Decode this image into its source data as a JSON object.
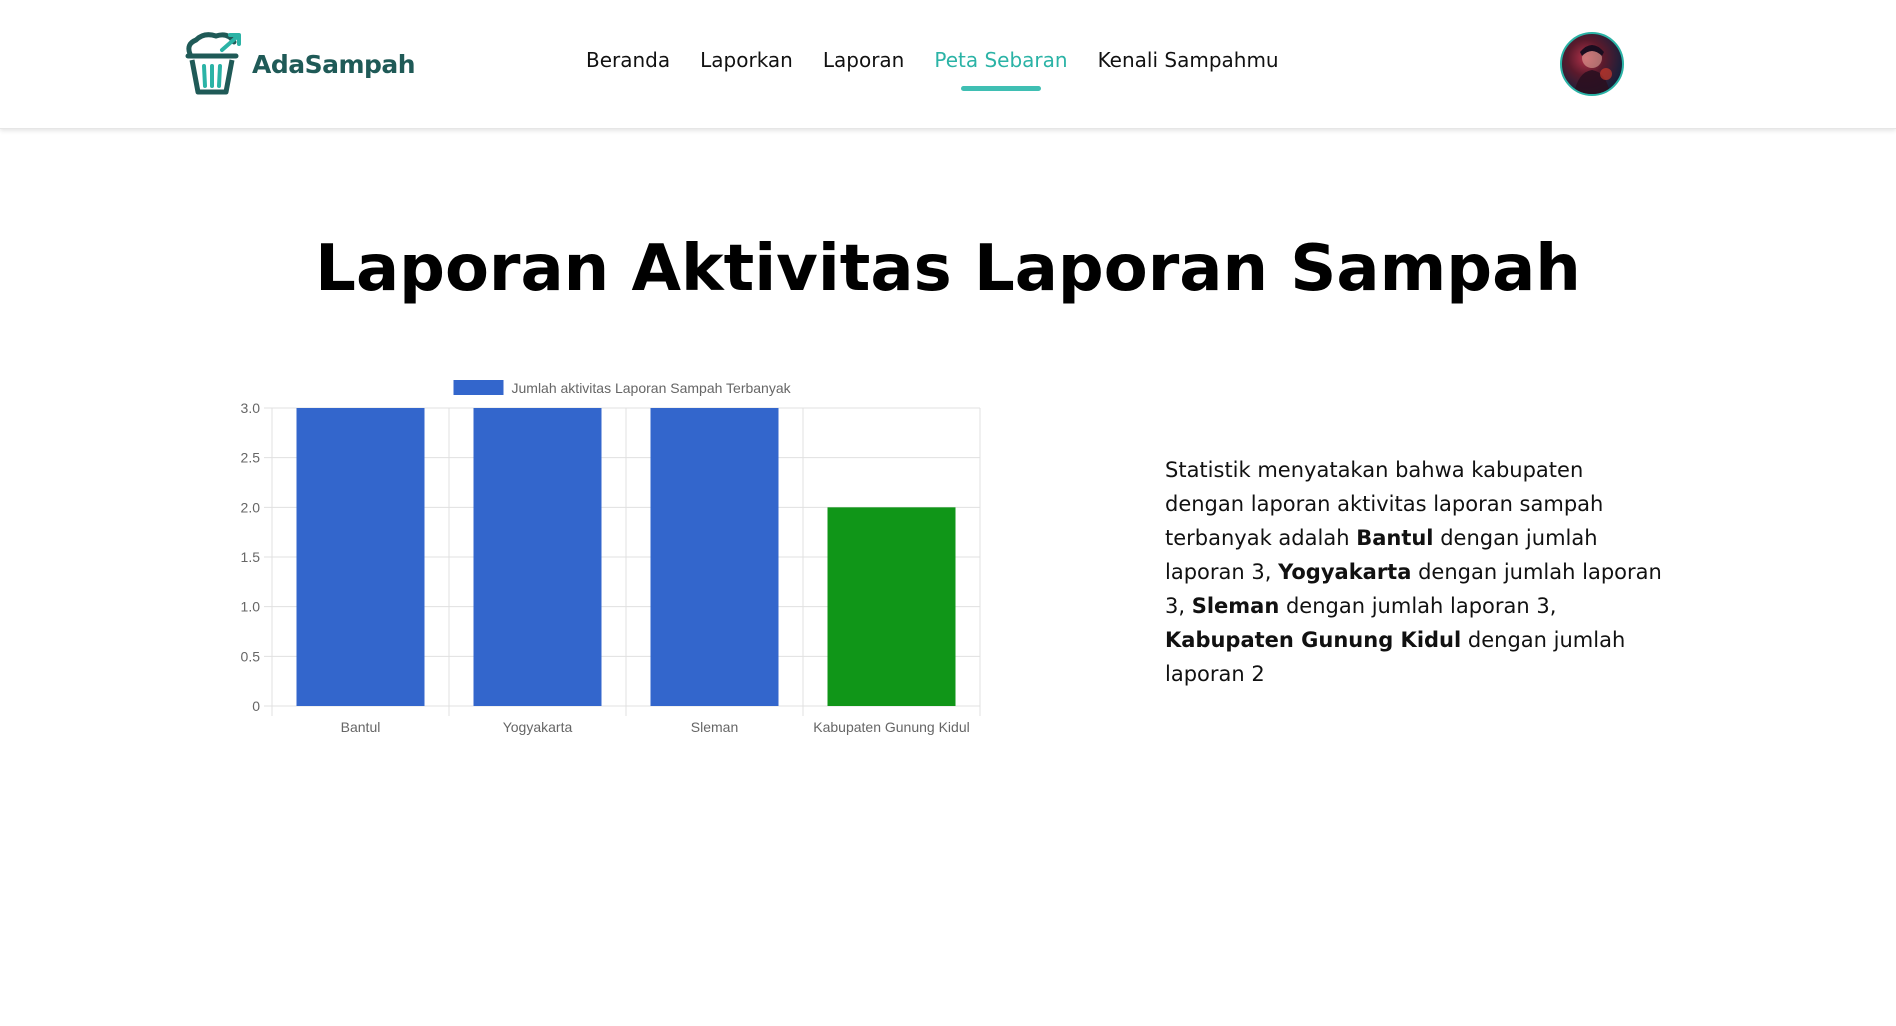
{
  "brand": {
    "name": "AdaSampah",
    "color": "#1f5a57",
    "accent": "#2bb3a6"
  },
  "nav": {
    "items": [
      {
        "label": "Beranda",
        "active": false
      },
      {
        "label": "Laporkan",
        "active": false
      },
      {
        "label": "Laporan",
        "active": false
      },
      {
        "label": "Peta Sebaran",
        "active": true
      },
      {
        "label": "Kenali Sampahmu",
        "active": false
      }
    ]
  },
  "page": {
    "title": "Laporan Aktivitas Laporan Sampah"
  },
  "chart_data": {
    "type": "bar",
    "categories": [
      "Bantul",
      "Yogyakarta",
      "Sleman",
      "Kabupaten Gunung Kidul"
    ],
    "series": [
      {
        "name": "Jumlah aktivitas Laporan Sampah Terbanyak",
        "values": [
          3,
          3,
          3,
          2
        ],
        "colors": [
          "#3366cc",
          "#3366cc",
          "#3366cc",
          "#109618"
        ]
      }
    ],
    "yticks": [
      "3.0",
      "2.5",
      "2.0",
      "1.5",
      "1.0",
      "0.5",
      "0"
    ],
    "ylim": [
      0,
      3
    ],
    "grid": true,
    "legend": "top"
  },
  "description": {
    "intro": "Statistik menyatakan bahwa kabupaten dengan laporan aktivitas laporan sampah terbanyak adalah ",
    "entries": [
      {
        "name": "Bantul",
        "text": " dengan jumlah laporan 3, "
      },
      {
        "name": "Yogyakarta",
        "text": " dengan jumlah laporan 3, "
      },
      {
        "name": "Sleman",
        "text": " dengan jumlah laporan 3, "
      },
      {
        "name": "Kabupaten Gunung Kidul",
        "text": " dengan jumlah laporan 2"
      }
    ]
  },
  "icons": {
    "logo": "trash-bin-logo-icon",
    "avatar": "user-avatar"
  }
}
